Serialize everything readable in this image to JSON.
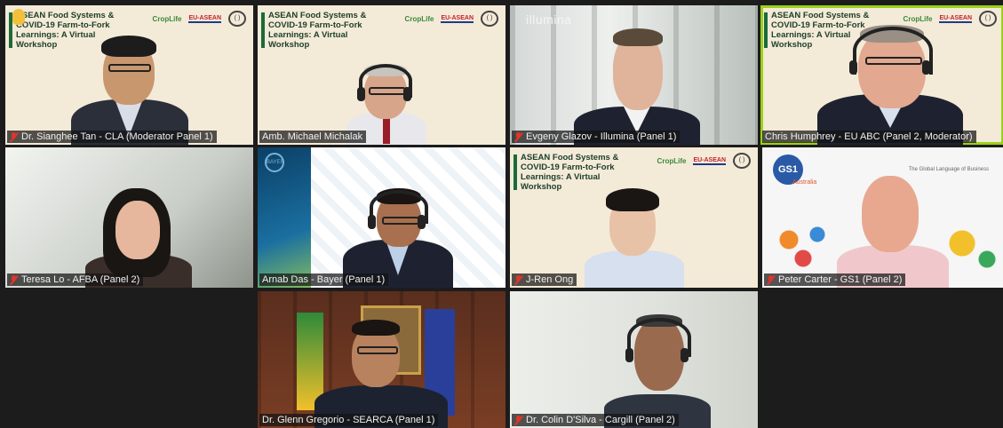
{
  "meeting": {
    "slide_title": "ASEAN Food Systems & COVID-19 Farm-to-Fork Learnings: A Virtual Workshop",
    "logos": {
      "croplife": "CropLife",
      "eu_asean": "EU-ASEAN",
      "circle": "( )"
    },
    "illumina_logo": "illumina",
    "gs1": {
      "logo": "GS1",
      "sub": "Australia",
      "tagline": "The Global Language of Business"
    },
    "bayer_logo": "BAYER"
  },
  "participants": [
    {
      "name": "Dr. Sianghee Tan - CLA (Moderator Panel 1)",
      "muted": true
    },
    {
      "name": "Amb. Michael Michalak",
      "muted": false
    },
    {
      "name": "Evgeny Glazov - Illumina (Panel 1)",
      "muted": true
    },
    {
      "name": "Chris Humphrey - EU ABC (Panel 2, Moderator)",
      "muted": false,
      "speaking": true
    },
    {
      "name": "Teresa Lo - AFBA (Panel 2)",
      "muted": true
    },
    {
      "name": "Arnab Das - Bayer (Panel 1)",
      "muted": false
    },
    {
      "name": "J-Ren Ong",
      "muted": true
    },
    {
      "name": "Peter Carter - GS1 (Panel 2)",
      "muted": true
    },
    {
      "name": "Dr. Glenn Gregorio - SEARCA (Panel 1)",
      "muted": false
    },
    {
      "name": "Dr. Colin D'Silva - Cargill (Panel 2)",
      "muted": true
    }
  ],
  "colors": {
    "background": "#1c1c1c",
    "speaking_outline": "#9bd11a",
    "mute_icon": "#e2342a",
    "slide_bg": "#f4ead8",
    "slide_title": "#1b3f2a"
  }
}
